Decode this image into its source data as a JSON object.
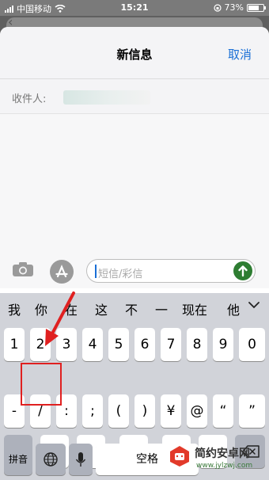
{
  "status": {
    "carrier": "中国移动",
    "time": "15:21",
    "battery": "73%"
  },
  "nav": {
    "title": "新信息",
    "cancel": "取消"
  },
  "recipient": {
    "label": "收件人:"
  },
  "compose": {
    "placeholder": "短信/彩信"
  },
  "candidates": [
    "我",
    "你",
    "在",
    "这",
    "不",
    "一",
    "现在",
    "他"
  ],
  "keys": {
    "row1": [
      "1",
      "2",
      "3",
      "4",
      "5",
      "6",
      "7",
      "8",
      "9",
      "0"
    ],
    "row2": [
      "-",
      "/",
      ":",
      ";",
      "(",
      ")",
      "¥",
      "@",
      "“",
      "”"
    ],
    "row3_left": "#+=",
    "row3": [
      "。",
      ",",
      "?",
      "!",
      "、"
    ],
    "pinyin": "拼音",
    "space": "空格"
  },
  "watermark": {
    "name": "简约安卓网",
    "url": "www.jylzwj.com"
  },
  "colors": {
    "accent": "#1a6fd6",
    "send": "#2e7d32",
    "highlight": "#e02020"
  }
}
